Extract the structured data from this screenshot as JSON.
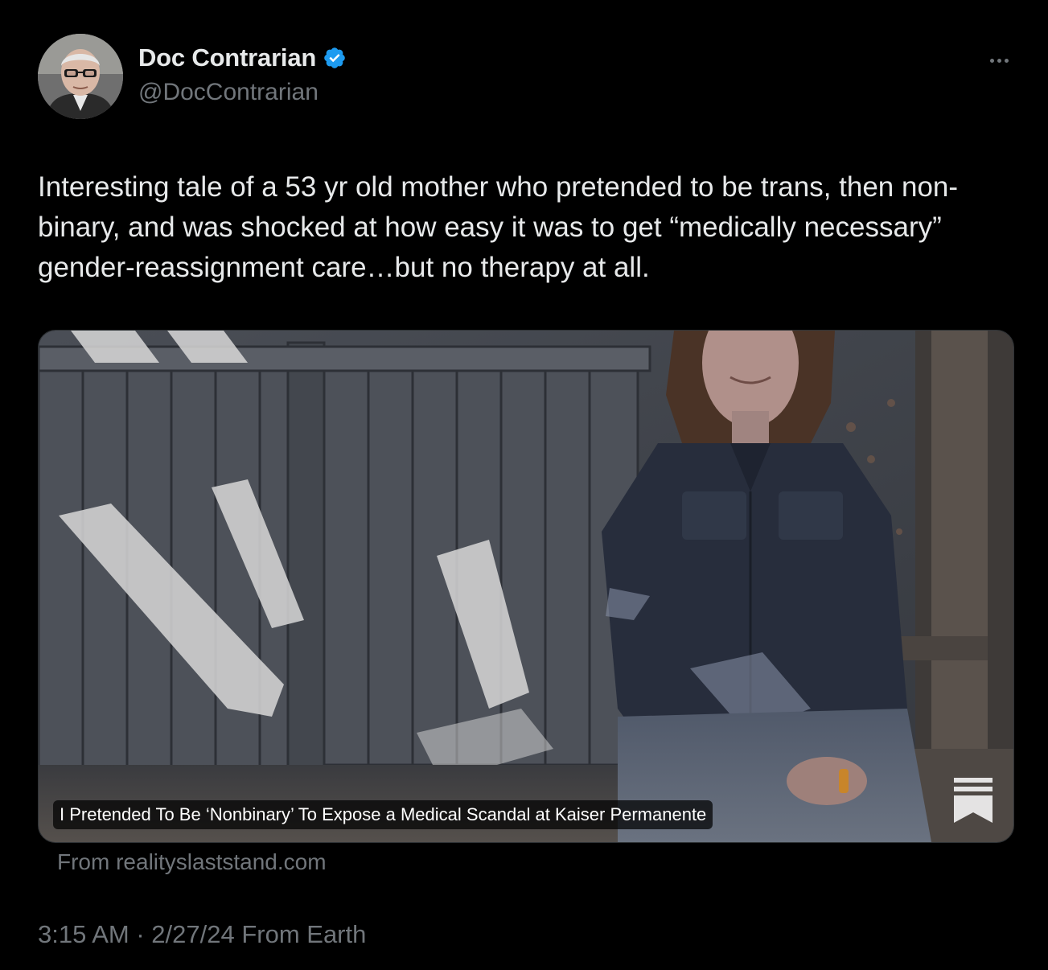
{
  "author": {
    "display_name": "Doc Contrarian",
    "handle": "@DocContrarian",
    "verified": true,
    "avatar_icon": "profile-avatar"
  },
  "tweet": {
    "text": "Interesting tale of a 53 yr old mother who pretended to be trans, then non-binary, and was shocked at how easy it was to get “medically necessary” gender-reassignment care…but no therapy at all."
  },
  "card": {
    "title": "I Pretended To Be ‘Nonbinary’ To Expose a Medical Scandal at Kaiser Permanente",
    "source": "From realityslaststand.com",
    "bookmark_icon": "substack-bookmark-icon"
  },
  "meta": {
    "timestamp": "3:15 AM · 2/27/24 From Earth"
  },
  "colors": {
    "background": "#000000",
    "text_primary": "#e7e9ea",
    "text_secondary": "#71767b",
    "verified_blue": "#1d9bf0"
  }
}
